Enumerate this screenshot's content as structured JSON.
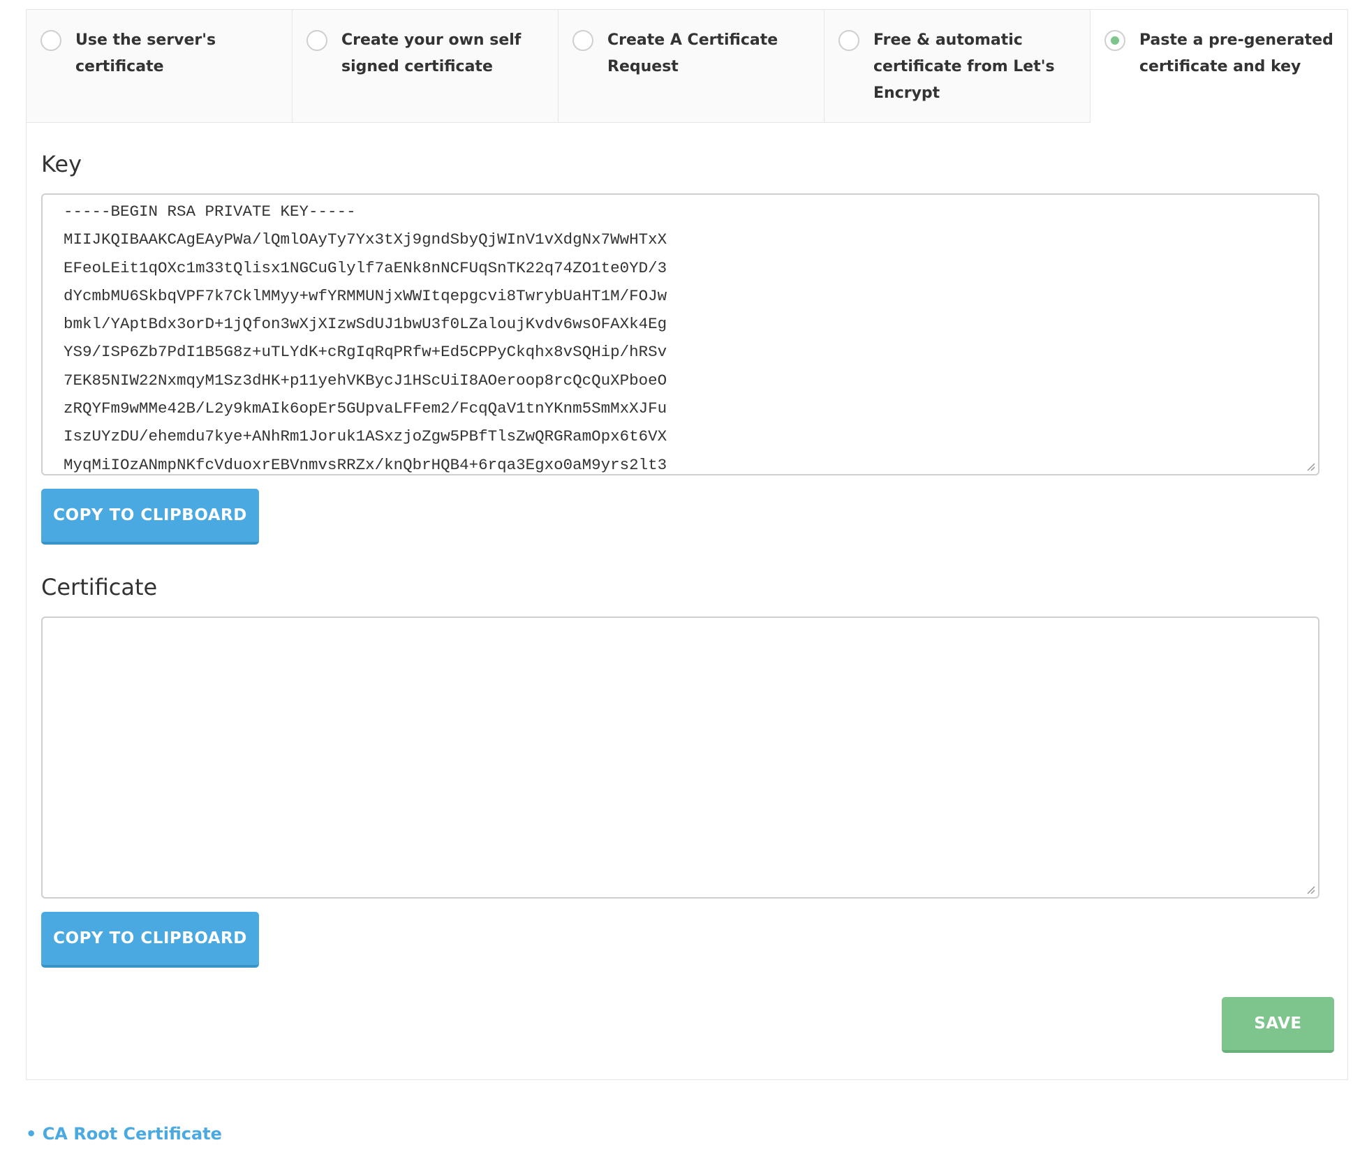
{
  "tabs": [
    {
      "label": "Use the server's certificate",
      "selected": false
    },
    {
      "label": "Create your own self signed certificate",
      "selected": false
    },
    {
      "label": "Create A Certificate Request",
      "selected": false
    },
    {
      "label": "Free & automatic certificate from Let's Encrypt",
      "selected": false
    },
    {
      "label": "Paste a pre-generated certificate and key",
      "selected": true
    }
  ],
  "key_section": {
    "title": "Key",
    "value": "-----BEGIN RSA PRIVATE KEY-----\nMIIJKQIBAAKCAgEAyPWa/lQmlOAyTy7Yx3tXj9gndSbyQjWInV1vXdgNx7WwHTxX\nEFeoLEit1qOXc1m33tQlisx1NGCuGlylf7aENk8nNCFUqSnTK22q74ZO1te0YD/3\ndYcmbMU6SkbqVPF7k7CklMMyy+wfYRMMUNjxWWItqepgcvi8TwrybUaHT1M/FOJw\nbmkl/YAptBdx3orD+1jQfon3wXjXIzwSdUJ1bwU3f0LZaloujKvdv6wsOFAXk4Eg\nYS9/ISP6Zb7PdI1B5G8z+uTLYdK+cRgIqRqPRfw+Ed5CPPyCkqhx8vSQHip/hRSv\n7EK85NIW22NxmqyM1Sz3dHK+p11yehVKBycJ1HScUiI8AOeroop8rcQcQuXPboeO\nzRQYFm9wMMe42B/L2y9kmAIk6opEr5GUpvaLFFem2/FcqQaV1tnYKnm5SmMxXJFu\nIszUYzDU/ehemdu7kye+ANhRm1Joruk1ASxzjoZgw5PBfTlsZwQRGRamOpx6t6VX\nMyqMiIOzANmpNKfcVduoxrEBVnmvsRRZx/knQbrHQB4+6rqa3Egxo0aM9yrs2lt3",
    "copy_button": "COPY TO CLIPBOARD"
  },
  "certificate_section": {
    "title": "Certificate",
    "value": "",
    "copy_button": "COPY TO CLIPBOARD"
  },
  "save_button": "SAVE",
  "footer_link": "• CA Root Certificate",
  "colors": {
    "accent_blue": "#49a9e0",
    "save_green": "#7dc48d",
    "radio_checked": "#7dc48d"
  }
}
